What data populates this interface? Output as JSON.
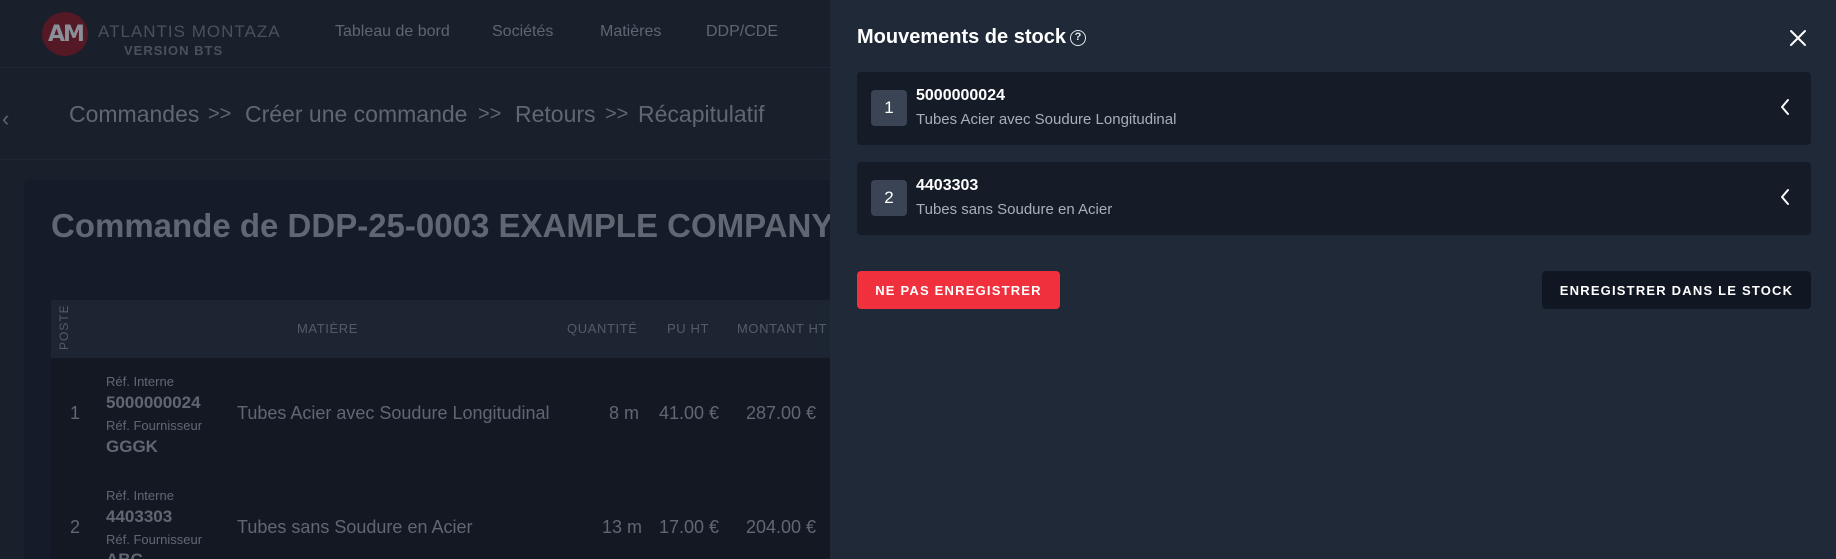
{
  "app": {
    "logo_name": "ATLANTIS MONTAZA",
    "logo_version": "VERSION BTS",
    "nav": [
      "Tableau de bord",
      "Sociétés",
      "Matières",
      "DDP/CDE"
    ]
  },
  "breadcrumb": [
    "Commandes",
    "Créer une commande",
    "Retours",
    "Récapitulatif"
  ],
  "breadcrumb_sep": ">>",
  "page_title": "Commande de DDP-25-0003 EXAMPLE COMPANY",
  "table": {
    "headers": {
      "poste": "POSTE",
      "matiere": "MATIÈRE",
      "quantite": "QUANTITÉ",
      "pu_ht": "PU HT",
      "montant_ht": "MONTANT HT"
    },
    "rows": [
      {
        "poste": "1",
        "ref_interne_label": "Réf. Interne",
        "ref_interne": "5000000024",
        "ref_fournisseur_label": "Réf. Fournisseur",
        "ref_fournisseur": "GGGK",
        "matiere": "Tubes Acier avec Soudure Longitudinal",
        "quantite": "8 m",
        "pu_ht": "41.00 €",
        "montant_ht": "287.00 €"
      },
      {
        "poste": "2",
        "ref_interne_label": "Réf. Interne",
        "ref_interne": "4403303",
        "ref_fournisseur_label": "Réf. Fournisseur",
        "ref_fournisseur": "ABC",
        "matiere": "Tubes sans Soudure en Acier",
        "quantite": "13 m",
        "pu_ht": "17.00 €",
        "montant_ht": "204.00 €"
      }
    ]
  },
  "drawer": {
    "title": "Mouvements de stock",
    "items": [
      {
        "num": "1",
        "code": "5000000024",
        "desc": "Tubes Acier avec Soudure Longitudinal"
      },
      {
        "num": "2",
        "code": "4403303",
        "desc": "Tubes sans Soudure en Acier"
      }
    ],
    "btn_discard": "NE PAS ENREGISTRER",
    "btn_save": "ENREGISTRER DANS LE STOCK"
  },
  "colors": {
    "accent_red": "#f0303d",
    "drawer_bg": "#1f2938"
  }
}
